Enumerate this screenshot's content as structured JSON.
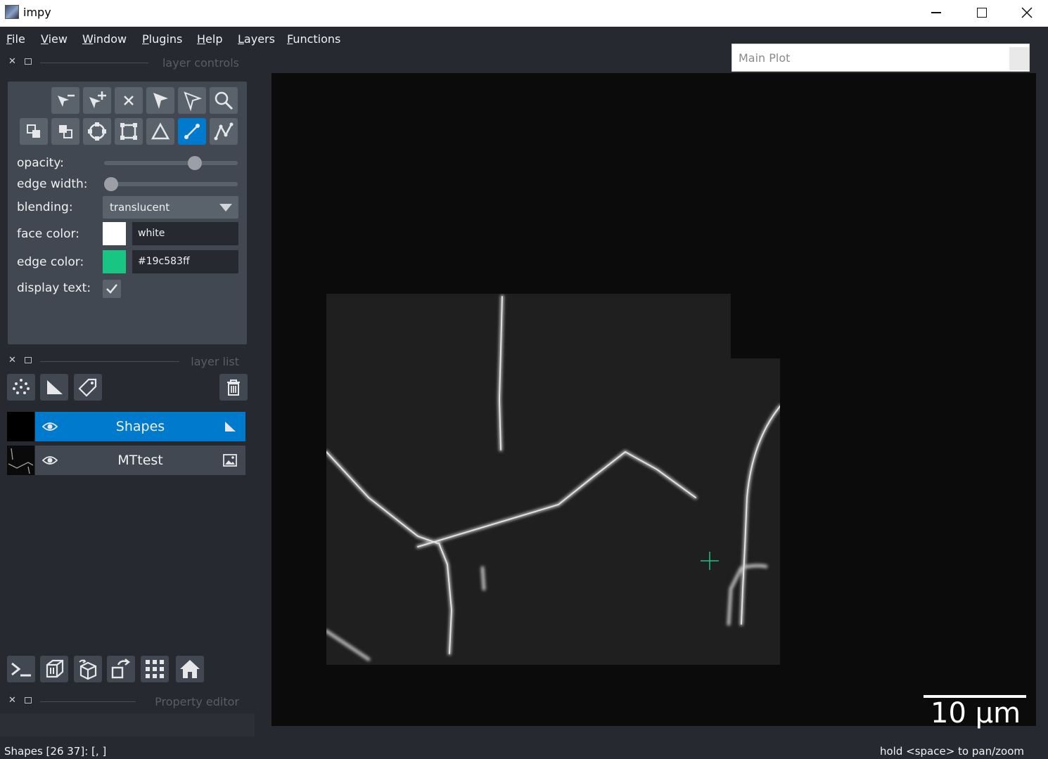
{
  "window": {
    "title": "impy",
    "icons": {
      "app": "napari-app-icon",
      "minimize": "minimize-icon",
      "maximize": "maximize-icon",
      "close": "close-icon"
    }
  },
  "menu": [
    "File",
    "View",
    "Window",
    "Plugins",
    "Help",
    "Layers",
    "Functions"
  ],
  "docks": {
    "layer_controls": {
      "label": "layer controls"
    },
    "layer_list": {
      "label": "layer list"
    },
    "property_editor": {
      "label": "Property editor"
    }
  },
  "controls": {
    "tools_row1": [
      "remove-vertex-icon",
      "add-vertex-icon",
      "delete-shape-icon",
      "select-icon",
      "direct-select-icon",
      "zoom-pan-icon"
    ],
    "tools_row2": [
      "move-front-icon",
      "move-back-icon",
      "ellipse-icon",
      "rectangle-icon",
      "polygon-icon",
      "line-icon",
      "path-icon"
    ],
    "active_tool": "line-icon",
    "opacity": {
      "label": "opacity:",
      "value": 0.7
    },
    "edge_width": {
      "label": "edge width:",
      "value": 0.0
    },
    "blending": {
      "label": "blending:",
      "value": "translucent"
    },
    "face_color": {
      "label": "face color:",
      "value": "white",
      "swatch": "#ffffff"
    },
    "edge_color": {
      "label": "edge color:",
      "value": "#19c583ff",
      "swatch": "#19c583"
    },
    "display_text": {
      "label": "display text:",
      "checked": true
    }
  },
  "layer_list_buttons": [
    "new-points-icon",
    "new-shapes-icon",
    "new-labels-icon",
    "delete-layer-icon"
  ],
  "layers": [
    {
      "name": "Shapes",
      "visible": true,
      "selected": true,
      "type_icon": "shapes-layer-icon"
    },
    {
      "name": "MTtest",
      "visible": true,
      "selected": false,
      "type_icon": "image-layer-icon"
    }
  ],
  "viewer_buttons": [
    "console-icon",
    "ndisplay-icon",
    "roll-dims-icon",
    "transpose-icon",
    "grid-icon",
    "home-icon"
  ],
  "canvas": {
    "scalebar": "10 µm"
  },
  "main_plot": {
    "title": "Main Plot"
  },
  "status": {
    "left": "Shapes [26 37]: [, ]",
    "right": "hold <space> to pan/zoom"
  }
}
